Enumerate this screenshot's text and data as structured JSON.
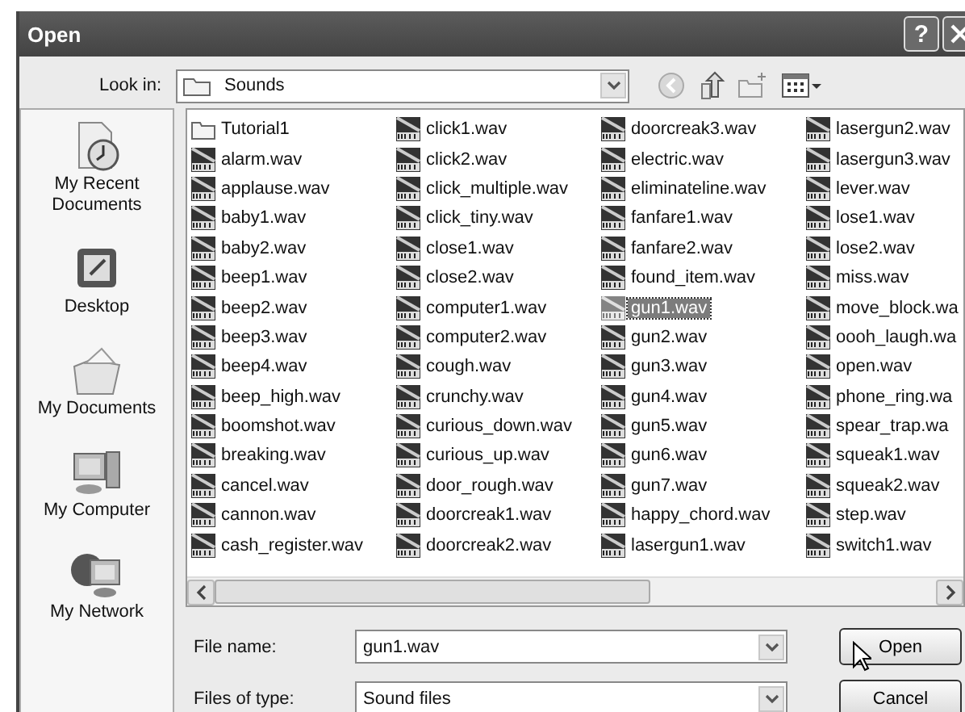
{
  "window": {
    "title": "Open",
    "help": "?"
  },
  "look_in": {
    "label": "Look in:",
    "value": "Sounds"
  },
  "places": [
    {
      "label": "My Recent Documents",
      "kind": "recent"
    },
    {
      "label": "Desktop",
      "kind": "desktop"
    },
    {
      "label": "My Documents",
      "kind": "documents"
    },
    {
      "label": "My Computer",
      "kind": "computer"
    },
    {
      "label": "My Network",
      "kind": "network"
    }
  ],
  "files": [
    {
      "name": "Tutorial1",
      "kind": "folder",
      "selected": false
    },
    {
      "name": "alarm.wav",
      "kind": "wav",
      "selected": false
    },
    {
      "name": "applause.wav",
      "kind": "wav",
      "selected": false
    },
    {
      "name": "baby1.wav",
      "kind": "wav",
      "selected": false
    },
    {
      "name": "baby2.wav",
      "kind": "wav",
      "selected": false
    },
    {
      "name": "beep1.wav",
      "kind": "wav",
      "selected": false
    },
    {
      "name": "beep2.wav",
      "kind": "wav",
      "selected": false
    },
    {
      "name": "beep3.wav",
      "kind": "wav",
      "selected": false
    },
    {
      "name": "beep4.wav",
      "kind": "wav",
      "selected": false
    },
    {
      "name": "beep_high.wav",
      "kind": "wav",
      "selected": false
    },
    {
      "name": "boomshot.wav",
      "kind": "wav",
      "selected": false
    },
    {
      "name": "breaking.wav",
      "kind": "wav",
      "selected": false
    },
    {
      "name": "cancel.wav",
      "kind": "wav",
      "selected": false
    },
    {
      "name": "cannon.wav",
      "kind": "wav",
      "selected": false
    },
    {
      "name": "cash_register.wav",
      "kind": "wav",
      "selected": false
    },
    {
      "name": "click1.wav",
      "kind": "wav",
      "selected": false
    },
    {
      "name": "click2.wav",
      "kind": "wav",
      "selected": false
    },
    {
      "name": "click_multiple.wav",
      "kind": "wav",
      "selected": false
    },
    {
      "name": "click_tiny.wav",
      "kind": "wav",
      "selected": false
    },
    {
      "name": "close1.wav",
      "kind": "wav",
      "selected": false
    },
    {
      "name": "close2.wav",
      "kind": "wav",
      "selected": false
    },
    {
      "name": "computer1.wav",
      "kind": "wav",
      "selected": false
    },
    {
      "name": "computer2.wav",
      "kind": "wav",
      "selected": false
    },
    {
      "name": "cough.wav",
      "kind": "wav",
      "selected": false
    },
    {
      "name": "crunchy.wav",
      "kind": "wav",
      "selected": false
    },
    {
      "name": "curious_down.wav",
      "kind": "wav",
      "selected": false
    },
    {
      "name": "curious_up.wav",
      "kind": "wav",
      "selected": false
    },
    {
      "name": "door_rough.wav",
      "kind": "wav",
      "selected": false
    },
    {
      "name": "doorcreak1.wav",
      "kind": "wav",
      "selected": false
    },
    {
      "name": "doorcreak2.wav",
      "kind": "wav",
      "selected": false
    },
    {
      "name": "doorcreak3.wav",
      "kind": "wav",
      "selected": false
    },
    {
      "name": "electric.wav",
      "kind": "wav",
      "selected": false
    },
    {
      "name": "eliminateline.wav",
      "kind": "wav",
      "selected": false
    },
    {
      "name": "fanfare1.wav",
      "kind": "wav",
      "selected": false
    },
    {
      "name": "fanfare2.wav",
      "kind": "wav",
      "selected": false
    },
    {
      "name": "found_item.wav",
      "kind": "wav",
      "selected": false
    },
    {
      "name": "gun1.wav",
      "kind": "wav",
      "selected": true
    },
    {
      "name": "gun2.wav",
      "kind": "wav",
      "selected": false
    },
    {
      "name": "gun3.wav",
      "kind": "wav",
      "selected": false
    },
    {
      "name": "gun4.wav",
      "kind": "wav",
      "selected": false
    },
    {
      "name": "gun5.wav",
      "kind": "wav",
      "selected": false
    },
    {
      "name": "gun6.wav",
      "kind": "wav",
      "selected": false
    },
    {
      "name": "gun7.wav",
      "kind": "wav",
      "selected": false
    },
    {
      "name": "happy_chord.wav",
      "kind": "wav",
      "selected": false
    },
    {
      "name": "lasergun1.wav",
      "kind": "wav",
      "selected": false
    },
    {
      "name": "lasergun2.wav",
      "kind": "wav",
      "selected": false
    },
    {
      "name": "lasergun3.wav",
      "kind": "wav",
      "selected": false
    },
    {
      "name": "lever.wav",
      "kind": "wav",
      "selected": false
    },
    {
      "name": "lose1.wav",
      "kind": "wav",
      "selected": false
    },
    {
      "name": "lose2.wav",
      "kind": "wav",
      "selected": false
    },
    {
      "name": "miss.wav",
      "kind": "wav",
      "selected": false
    },
    {
      "name": "move_block.wa",
      "kind": "wav",
      "selected": false
    },
    {
      "name": "oooh_laugh.wa",
      "kind": "wav",
      "selected": false
    },
    {
      "name": "open.wav",
      "kind": "wav",
      "selected": false
    },
    {
      "name": "phone_ring.wa",
      "kind": "wav",
      "selected": false
    },
    {
      "name": "spear_trap.wa",
      "kind": "wav",
      "selected": false
    },
    {
      "name": "squeak1.wav",
      "kind": "wav",
      "selected": false
    },
    {
      "name": "squeak2.wav",
      "kind": "wav",
      "selected": false
    },
    {
      "name": "step.wav",
      "kind": "wav",
      "selected": false
    },
    {
      "name": "switch1.wav",
      "kind": "wav",
      "selected": false
    }
  ],
  "file_name": {
    "label": "File name:",
    "value": "gun1.wav"
  },
  "file_type": {
    "label": "Files of type:",
    "value": "Sound files"
  },
  "buttons": [
    "Open",
    "Cancel"
  ]
}
